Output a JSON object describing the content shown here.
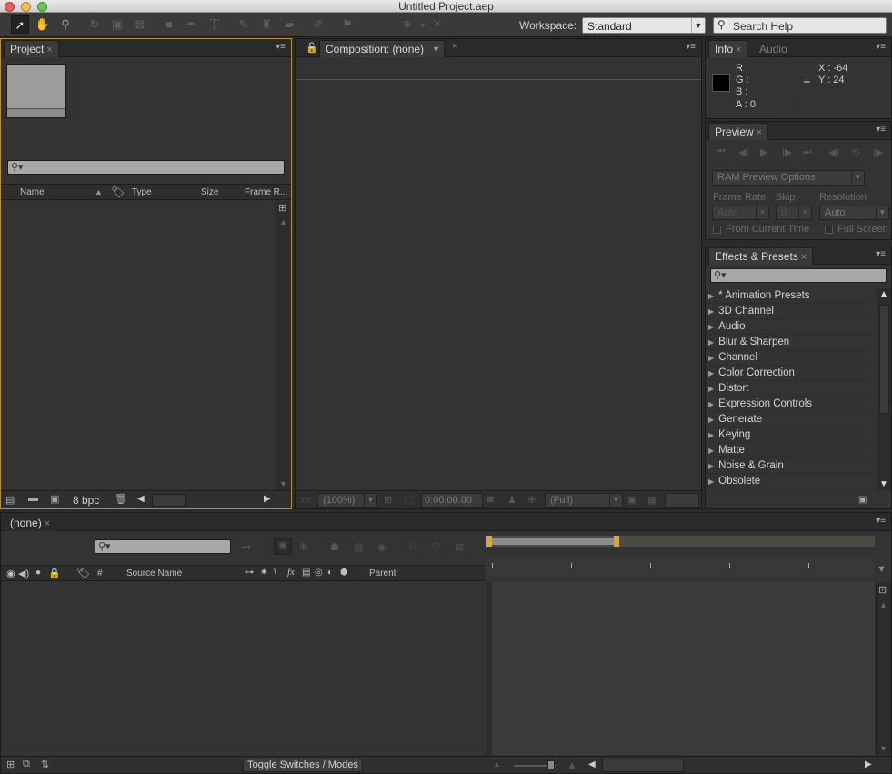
{
  "window": {
    "title": "Untitled Project.aep"
  },
  "toolbar": {
    "workspace_label": "Workspace:",
    "workspace_value": "Standard",
    "search_help_placeholder": "Search Help",
    "tools": [
      "selection-icon",
      "hand-icon",
      "zoom-icon",
      "rotation-icon",
      "camera-orbit-icon",
      "pan-behind-icon",
      "rectangle-icon",
      "pen-icon",
      "type-icon",
      "brush-icon",
      "clone-stamp-icon",
      "eraser-icon",
      "roto-brush-icon",
      "puppet-pin-icon"
    ]
  },
  "project": {
    "tab_label": "Project",
    "columns": [
      "Name",
      "Type",
      "Size",
      "Frame R..."
    ],
    "footer_bpc": "8 bpc"
  },
  "composition": {
    "tab_label": "Composition: (none)",
    "zoom": "(100%)",
    "timecode": "0:00:00:00",
    "resolution": "(Full)"
  },
  "info": {
    "tabs": [
      "Info",
      "Audio"
    ],
    "labels": {
      "r": "R :",
      "g": "G :",
      "b": "B :",
      "a": "A : 0",
      "x": "X : -64",
      "y": "Y : 24"
    }
  },
  "preview": {
    "tab_label": "Preview",
    "ram_preview": "RAM Preview Options",
    "frame_rate_label": "Frame Rate",
    "skip_label": "Skip",
    "resolution_label": "Resolution",
    "frame_rate_value": "Auto",
    "skip_value": "0",
    "resolution_value": "Auto",
    "from_current_time": "From Current Time",
    "full_screen": "Full Screen"
  },
  "effects": {
    "tab_label": "Effects & Presets",
    "items": [
      "* Animation Presets",
      "3D Channel",
      "Audio",
      "Blur & Sharpen",
      "Channel",
      "Color Correction",
      "Distort",
      "Expression Controls",
      "Generate",
      "Keying",
      "Matte",
      "Noise & Grain",
      "Obsolete"
    ]
  },
  "timeline": {
    "tab_label": "(none)",
    "columns": {
      "number": "#",
      "source_name": "Source Name",
      "parent": "Parent"
    },
    "toggle_label": "Toggle Switches / Modes"
  }
}
